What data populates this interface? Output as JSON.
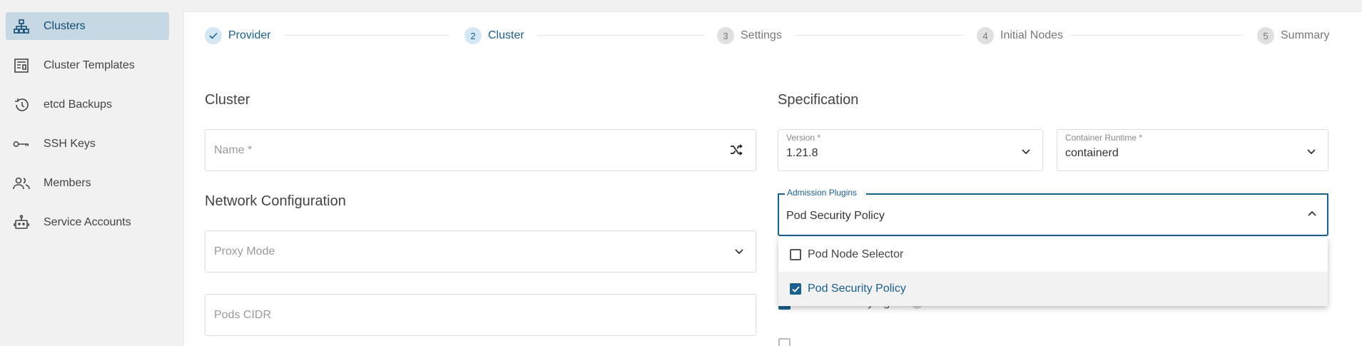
{
  "sidebar": {
    "items": [
      {
        "label": "Clusters",
        "icon": "sitemap-icon",
        "active": true
      },
      {
        "label": "Cluster Templates",
        "icon": "template-icon"
      },
      {
        "label": "etcd Backups",
        "icon": "history-icon"
      },
      {
        "label": "SSH Keys",
        "icon": "key-icon"
      },
      {
        "label": "Members",
        "icon": "members-icon"
      },
      {
        "label": "Service Accounts",
        "icon": "robot-icon"
      }
    ]
  },
  "stepper": {
    "steps": [
      {
        "number": "✓",
        "label": "Provider",
        "state": "done"
      },
      {
        "number": "2",
        "label": "Cluster",
        "state": "current"
      },
      {
        "number": "3",
        "label": "Settings",
        "state": "pending"
      },
      {
        "number": "4",
        "label": "Initial Nodes",
        "state": "pending"
      },
      {
        "number": "5",
        "label": "Summary",
        "state": "pending"
      }
    ]
  },
  "cluster": {
    "heading": "Cluster",
    "name_placeholder": "Name *"
  },
  "network": {
    "heading": "Network Configuration",
    "proxy_placeholder": "Proxy Mode",
    "pods_cidr_placeholder": "Pods CIDR"
  },
  "spec": {
    "heading": "Specification",
    "version_label": "Version *",
    "version_value": "1.21.8",
    "runtime_label": "Container Runtime *",
    "runtime_value": "containerd",
    "admission_label": "Admission Plugins",
    "admission_value": "Pod Security Policy",
    "options": [
      {
        "label": "Pod Node Selector",
        "checked": false
      },
      {
        "label": "Pod Security Policy",
        "checked": true
      }
    ],
    "user_ssh_label": "User SSH Key Agent",
    "info_glyph": "i"
  },
  "colors": {
    "accent": "#19608f",
    "active_bg": "#c7d8e5"
  }
}
